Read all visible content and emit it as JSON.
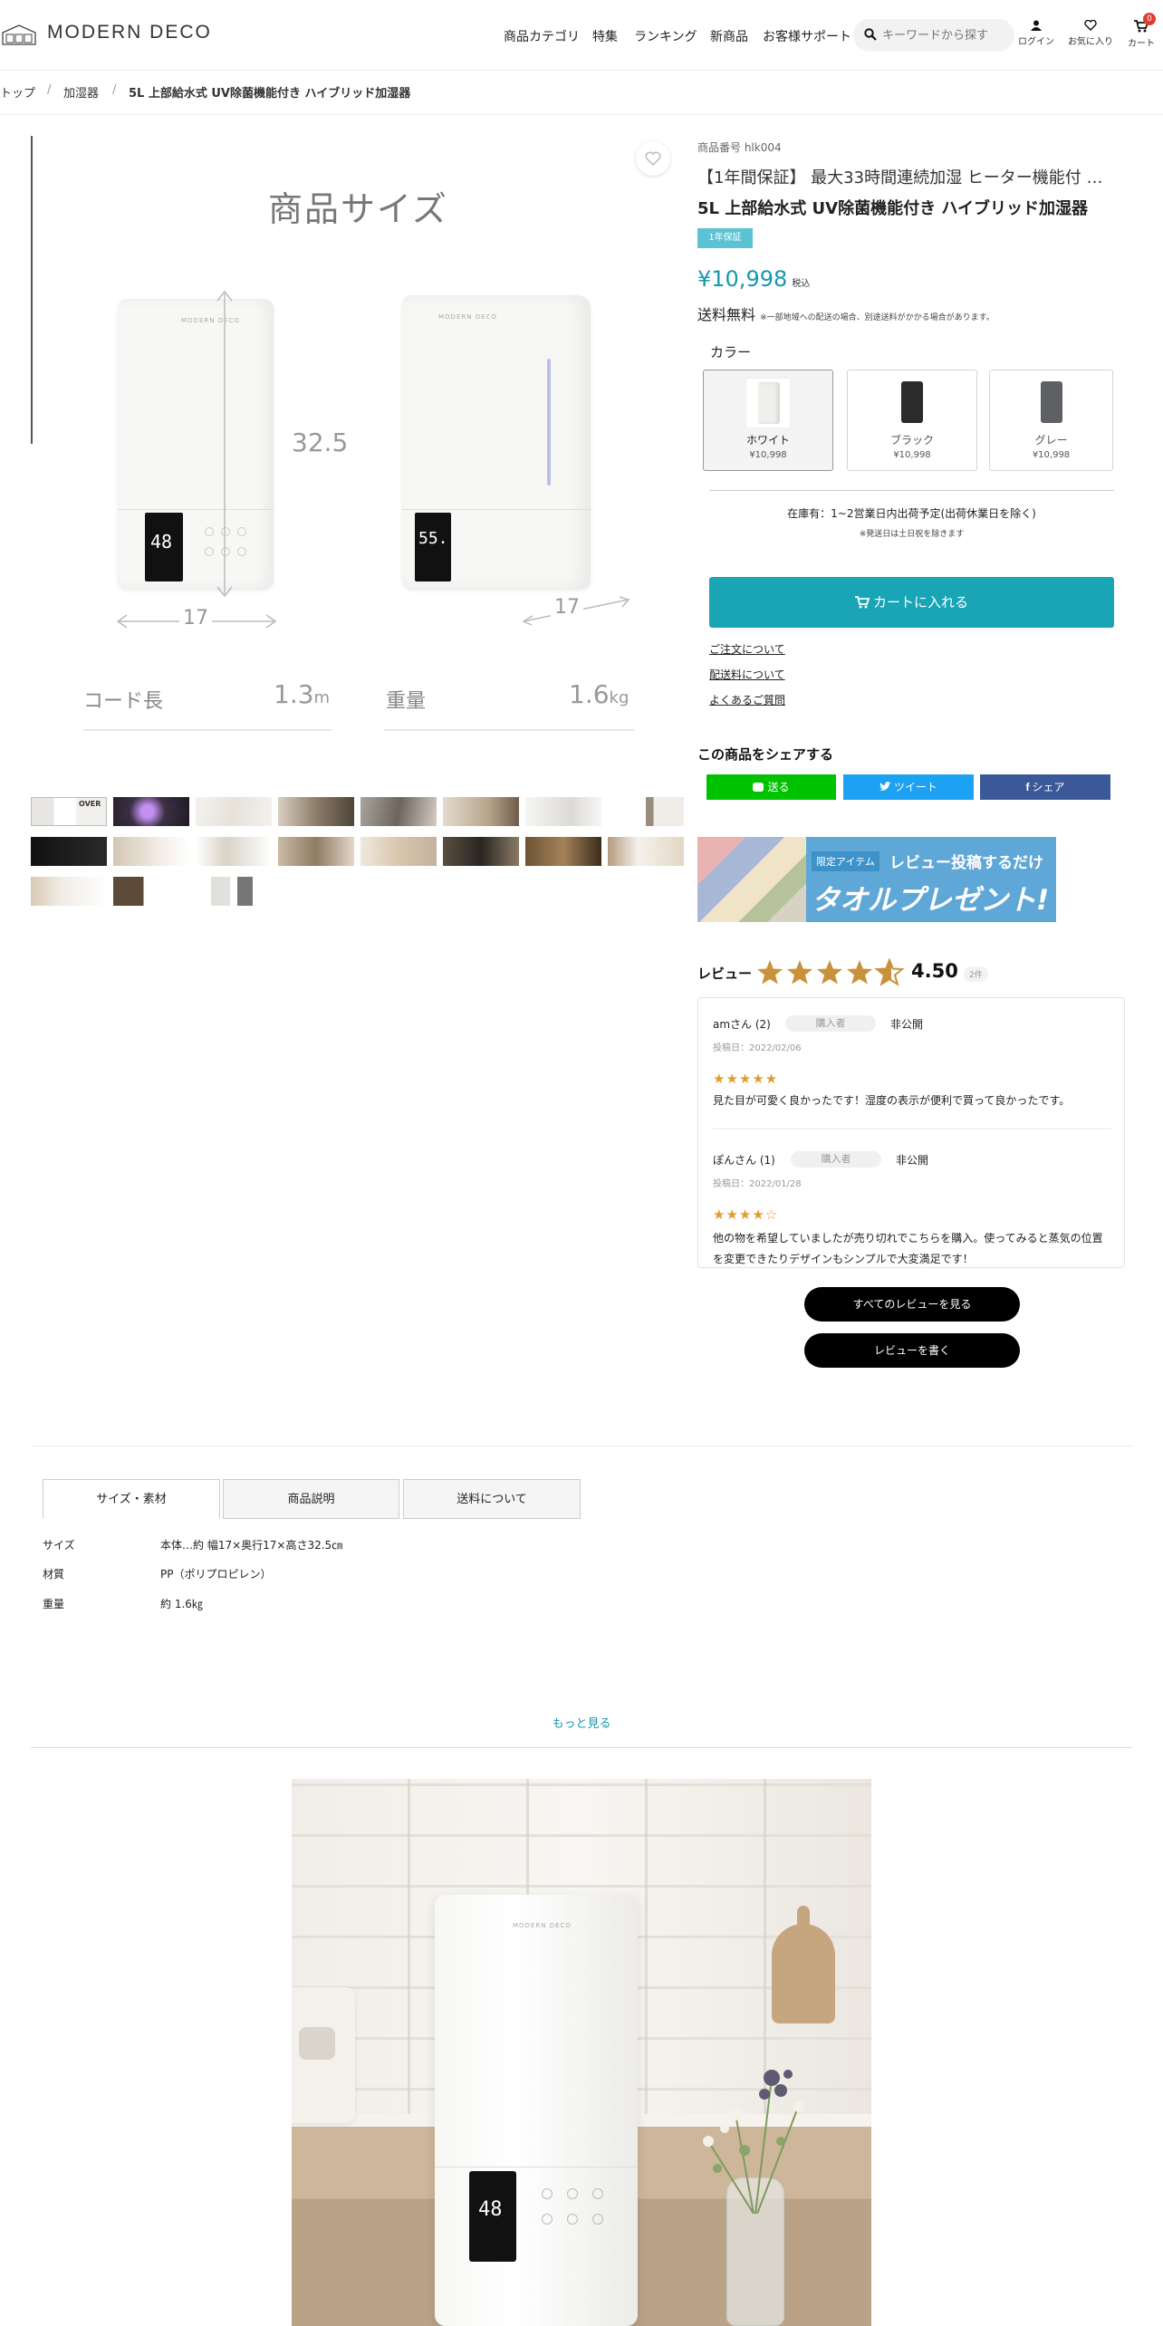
{
  "header": {
    "logo_text": "MODERN DECO",
    "nav": [
      "商品カテゴリ",
      "特集",
      "ランキング",
      "新商品",
      "お客様サポート"
    ],
    "search_placeholder": "キーワードから探す",
    "login_label": "ログイン",
    "favorites_label": "お気に入り",
    "cart_label": "カート",
    "cart_count": "0"
  },
  "breadcrumb": [
    "トップ",
    "加湿器",
    "5L 上部給水式 UV除菌機能付き ハイブリッド加湿器"
  ],
  "gallery": {
    "main_title": "商品サイズ",
    "height_dim": "32.5",
    "width_dim_front": "17",
    "width_dim_side": "17",
    "display_front": "48",
    "display_side": "55.",
    "cord_label": "コード長",
    "cord_value": "1.3",
    "cord_unit": "m",
    "weight_label": "重量",
    "weight_value": "1.6",
    "weight_unit": "kg",
    "thumb_text": "OVER"
  },
  "product": {
    "number": "商品番号 hlk004",
    "title_line1": "【1年間保証】 最大33時間連続加湿 ヒーター機能付 …",
    "title_line2": "5L 上部給水式 UV除菌機能付き ハイブリッド加湿器",
    "guarantee_badge": "1年保証",
    "price": "¥10,998",
    "tax_label": "税込",
    "shipping": "送料無料",
    "shipping_note": "※一部地域への配送の場合、別途送料がかかる場合があります。",
    "color_label": "カラー",
    "colors": [
      {
        "name": "ホワイト",
        "price": "¥10,998",
        "swatch": "#f0efec"
      },
      {
        "name": "ブラック",
        "price": "¥10,998",
        "swatch": "#2a2b2d"
      },
      {
        "name": "グレー",
        "price": "¥10,998",
        "swatch": "#5e6064"
      }
    ],
    "stock": "在庫有：1~2営業日内出荷予定(出荷休業日を除く)",
    "stock_note": "※発送日は土日祝を除きます",
    "cart_button": "カートに入れる",
    "links": [
      "ご注文について",
      "配送料について",
      "よくあるご質問"
    ]
  },
  "share": {
    "title": "この商品をシェアする",
    "line": "送る",
    "twitter": "ツイート",
    "facebook": "シェア"
  },
  "banner": {
    "tag": "限定アイテム",
    "text1": "レビュー投稿するだけ",
    "text2": "タオルプレゼント!"
  },
  "reviews": {
    "label": "レビュー",
    "rating": "4.50",
    "count": "2件",
    "items": [
      {
        "name": "amさん (2)",
        "badge": "購入者",
        "status": "非公開",
        "date": "投稿日：2022/02/06",
        "stars": "★★★★★",
        "text": "見た目が可愛く良かったです！湿度の表示が便利で買って良かったです。"
      },
      {
        "name": "ぽんさん (1)",
        "badge": "購入者",
        "status": "非公開",
        "date": "投稿日：2022/01/28",
        "stars": "★★★★☆",
        "text": "他の物を希望していましたが売り切れでこちらを購入。使ってみると蒸気の位置を変更できたりデザインもシンプルで大変満足です！"
      }
    ],
    "see_all": "すべてのレビューを見る",
    "write": "レビューを書く"
  },
  "tabs": [
    "サイズ・素材",
    "商品説明",
    "送料について"
  ],
  "specs": [
    {
      "label": "サイズ",
      "value": "本体…約 幅17×奥行17×高さ32.5㎝"
    },
    {
      "label": "材質",
      "value": "PP（ポリプロピレン）"
    },
    {
      "label": "重量",
      "value": "約 1.6㎏"
    }
  ],
  "more_link": "もっと見る",
  "lifestyle": {
    "brand": "MODERN DECO",
    "display": "48"
  },
  "colors": {
    "accent": "#19a5b6",
    "price": "#1598ab",
    "star": "#e39b2e",
    "line": "#00c300",
    "twitter": "#1da1f2",
    "facebook": "#3b5998"
  }
}
